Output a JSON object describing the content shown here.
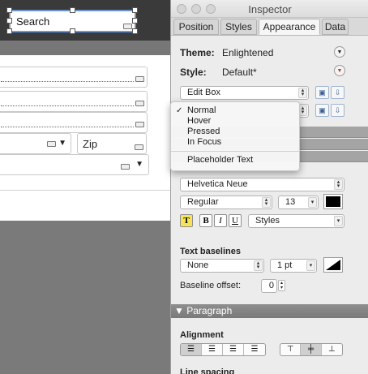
{
  "canvas": {
    "search_field_text": "Search",
    "zip_field_text": "Zip"
  },
  "inspector": {
    "window_title": "Inspector",
    "tabs": [
      {
        "label": "Position"
      },
      {
        "label": "Styles"
      },
      {
        "label": "Appearance"
      },
      {
        "label": "Data"
      }
    ],
    "active_tab": "Appearance",
    "theme_label": "Theme:",
    "theme_value": "Enlightened",
    "style_label": "Style:",
    "style_value": "Default*",
    "object_type_value": "Edit Box",
    "font_family_value": "Helvetica Neue",
    "font_style_value": "Regular",
    "font_size_value": "13",
    "text_color": "#000000",
    "format_buttons": {
      "highlight": "T",
      "bold": "B",
      "italic": "I",
      "underline": "U"
    },
    "styles_popup_value": "Styles",
    "text_baselines_label": "Text baselines",
    "baseline_style_value": "None",
    "baseline_size_value": "1 pt",
    "baseline_offset_label": "Baseline offset:",
    "baseline_offset_value": "0",
    "paragraph_section_label": "Paragraph",
    "alignment_label": "Alignment",
    "line_spacing_label": "Line spacing"
  },
  "state_menu": {
    "items": [
      {
        "label": "Normal",
        "checked": true
      },
      {
        "label": "Hover",
        "checked": false
      },
      {
        "label": "Pressed",
        "checked": false
      },
      {
        "label": "In Focus",
        "checked": false
      }
    ],
    "extra_item": "Placeholder Text"
  },
  "colors": {
    "selection_blue": "#4a8ef0",
    "section_header": "#7a7a7a",
    "style_indicator_red": "#c0392b"
  }
}
